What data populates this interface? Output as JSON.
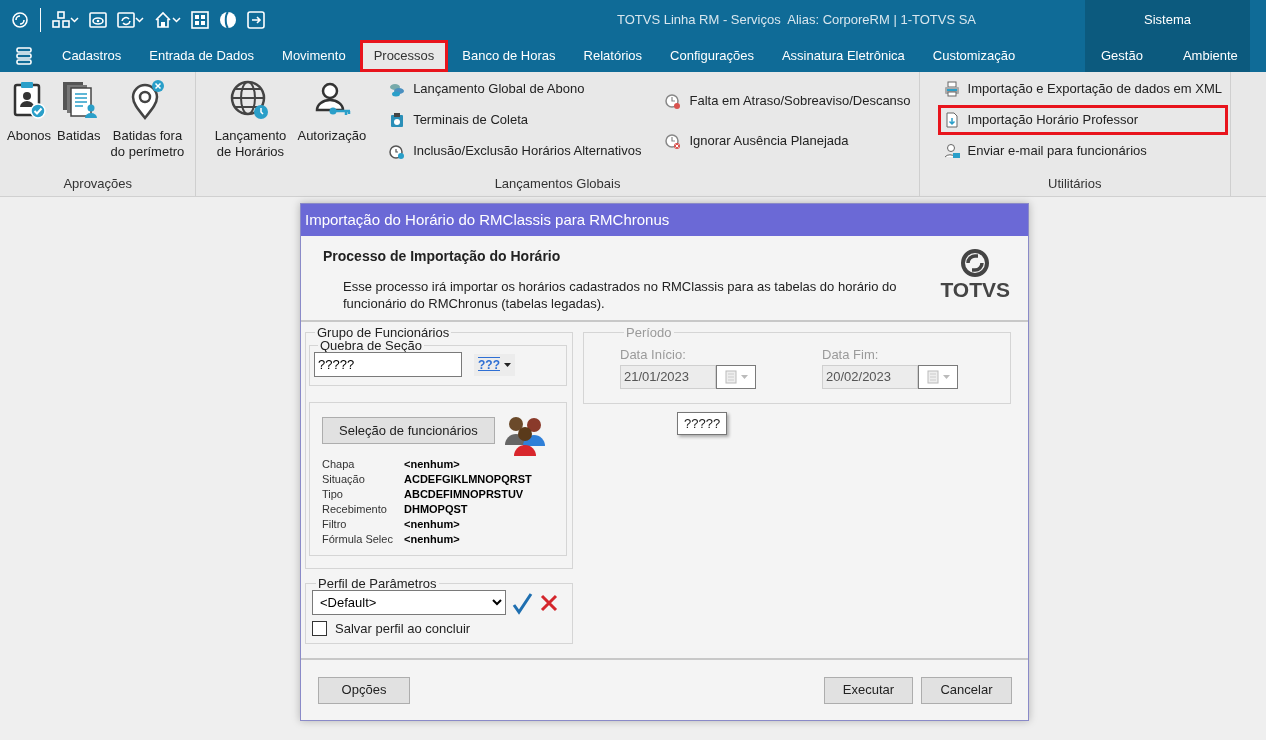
{
  "title_bar": {
    "title": "TOTVS Linha RM - Serviços  Alias: CorporeRM | 1-TOTVS SA",
    "context_label": "Sistema"
  },
  "menu_tabs": [
    {
      "label": "Cadastros",
      "kind": "main",
      "selected": false,
      "highlighted": false
    },
    {
      "label": "Entrada de Dados",
      "kind": "main",
      "selected": false,
      "highlighted": false
    },
    {
      "label": "Movimento",
      "kind": "main",
      "selected": false,
      "highlighted": false
    },
    {
      "label": "Processos",
      "kind": "main",
      "selected": true,
      "highlighted": true
    },
    {
      "label": "Banco de Horas",
      "kind": "main",
      "selected": false,
      "highlighted": false
    },
    {
      "label": "Relatórios",
      "kind": "main",
      "selected": false,
      "highlighted": false
    },
    {
      "label": "Configurações",
      "kind": "main",
      "selected": false,
      "highlighted": false
    },
    {
      "label": "Assinatura Eletrônica",
      "kind": "main",
      "selected": false,
      "highlighted": false
    },
    {
      "label": "Customização",
      "kind": "main",
      "selected": false,
      "highlighted": false
    },
    {
      "label": "Gestão",
      "kind": "context",
      "selected": false,
      "highlighted": false
    },
    {
      "label": "Ambiente",
      "kind": "context",
      "selected": false,
      "highlighted": false
    }
  ],
  "ribbon": {
    "groups": [
      {
        "label": "Aprovações",
        "large_items": [
          {
            "label": "Abonos"
          },
          {
            "label": "Batidas"
          },
          {
            "label": "Batidas fora do perímetro"
          }
        ]
      },
      {
        "label": "Lançamentos Globais",
        "large_items": [
          {
            "label": "Lançamento de Horários"
          },
          {
            "label": "Autorização"
          }
        ],
        "small_columns": [
          [
            {
              "label": "Lançamento Global de Abono",
              "highlighted": false
            },
            {
              "label": "Terminais de Coleta",
              "highlighted": false
            },
            {
              "label": "Inclusão/Exclusão Horários Alternativos",
              "highlighted": false
            }
          ],
          [
            {
              "label": "Falta em Atraso/Sobreaviso/Descanso",
              "highlighted": false
            },
            {
              "label": "Ignorar Ausência Planejada",
              "highlighted": false
            }
          ]
        ]
      },
      {
        "label": "Utilitários",
        "small_columns": [
          [
            {
              "label": "Importação e Exportação de dados em XML",
              "highlighted": false
            },
            {
              "label": "Importação Horário Professor",
              "highlighted": true
            },
            {
              "label": "Enviar e-mail para funcionários",
              "highlighted": false
            }
          ]
        ]
      }
    ]
  },
  "dialog": {
    "title": "Importação do Horário do RMClassis para RMChronus",
    "heading": "Processo de Importação do Horário",
    "description": "Esse processo irá importar os horários cadastrados no RMClassis para as tabelas do horário do funcionário do RMChronus (tabelas legadas).",
    "logo_text": "TOTVS",
    "employee_group": {
      "legend": "Grupo de Funcionários",
      "section_break": {
        "legend": "Quebra de Seção",
        "value": "?????",
        "button_label": "???"
      },
      "selection": {
        "button": "Seleção de funcionários",
        "fields": [
          {
            "label": "Chapa",
            "value": "<nenhum>"
          },
          {
            "label": "Situação",
            "value": "ACDEFGIKLMNOPQRST"
          },
          {
            "label": "Tipo",
            "value": "ABCDEFIMNOPRSTUV"
          },
          {
            "label": "Recebimento",
            "value": "DHMOPQST"
          },
          {
            "label": "Filtro",
            "value": "<nenhum>"
          },
          {
            "label": "Fórmula Selec",
            "value": "<nenhum>"
          }
        ]
      }
    },
    "parameter_profile": {
      "legend": "Perfil de Parâmetros",
      "value": "<Default>",
      "save_checkbox": {
        "label": "Salvar perfil ao concluir",
        "checked": false
      }
    },
    "period": {
      "legend": "Período",
      "disabled": true,
      "start": {
        "label": "Data Início:",
        "value": "21/01/2023"
      },
      "end": {
        "label": "Data Fim:",
        "value": "20/02/2023"
      }
    },
    "tooltip": "?????",
    "buttons": {
      "options": "Opções",
      "execute": "Executar",
      "cancel": "Cancelar"
    }
  }
}
